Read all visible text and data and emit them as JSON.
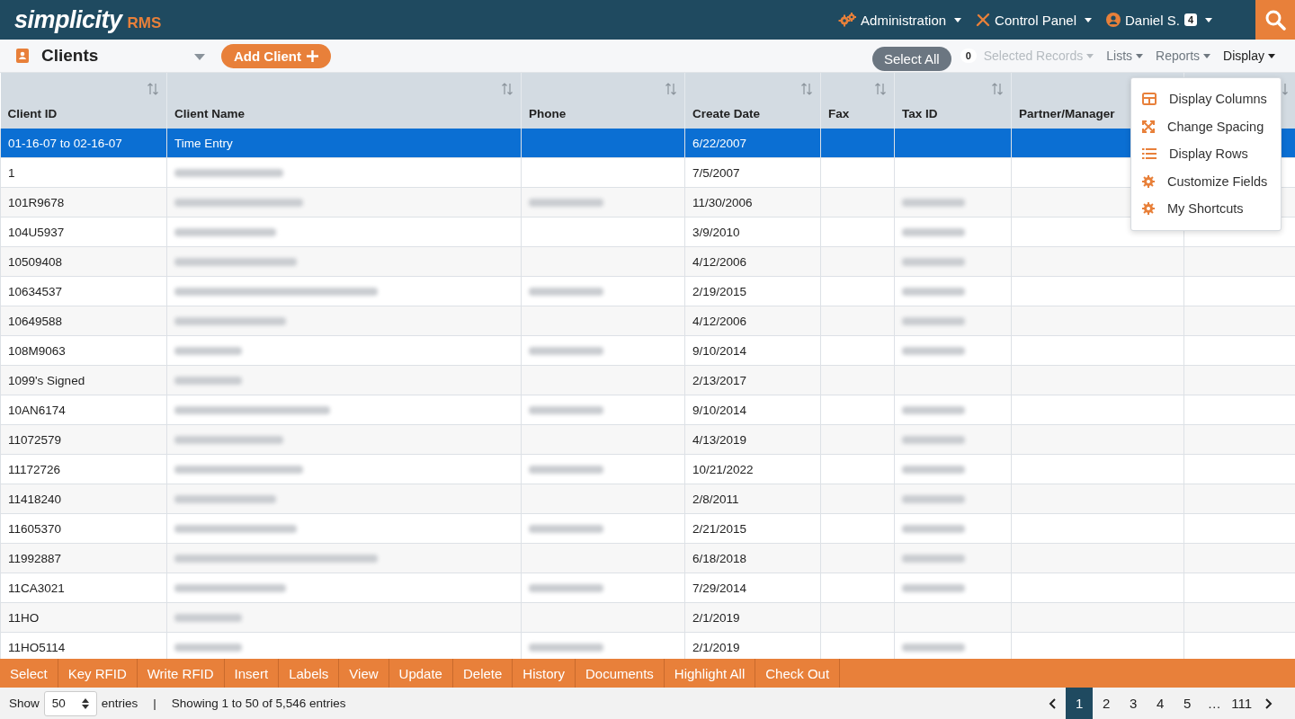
{
  "brand": {
    "name": "simplicity",
    "suffix": "RMS"
  },
  "nav": [
    {
      "kind": "gears",
      "label": "Administration"
    },
    {
      "kind": "tools",
      "label": "Control Panel"
    },
    {
      "kind": "user",
      "label": "Daniel S.",
      "badge": "4"
    }
  ],
  "page": {
    "title": "Clients",
    "add_button": "Add Client"
  },
  "actions": {
    "select_all": "Select All",
    "selected_count": "0",
    "menus": [
      {
        "label": "Selected Records",
        "disabled": true
      },
      {
        "label": "Lists",
        "disabled": false
      },
      {
        "label": "Reports",
        "disabled": false
      },
      {
        "label": "Display",
        "disabled": false,
        "expanded": true
      }
    ]
  },
  "display_menu": [
    {
      "kind": "table",
      "label": "Display Columns"
    },
    {
      "kind": "expand",
      "label": "Change Spacing"
    },
    {
      "kind": "list",
      "label": "Display Rows"
    },
    {
      "kind": "gear",
      "label": "Customize Fields"
    },
    {
      "kind": "gear",
      "label": "My Shortcuts"
    }
  ],
  "table": {
    "columns": [
      "Client ID",
      "Client Name",
      "Phone",
      "Create Date",
      "Fax",
      "Tax ID",
      "Partner/Manager"
    ],
    "rows": [
      {
        "client_id": "01-16-07 to 02-16-07",
        "client_name": "Time Entry",
        "name_blurred": false,
        "phone_blurred": false,
        "create_date": "6/22/2007",
        "tax_blurred": false,
        "selected": true
      },
      {
        "client_id": "1",
        "name_blurred": true,
        "phone_blurred": false,
        "create_date": "7/5/2007",
        "tax_blurred": false,
        "selected": false
      },
      {
        "client_id": "101R9678",
        "name_blurred": true,
        "phone_blurred": true,
        "create_date": "11/30/2006",
        "tax_blurred": true,
        "selected": false
      },
      {
        "client_id": "104U5937",
        "name_blurred": true,
        "phone_blurred": false,
        "create_date": "3/9/2010",
        "tax_blurred": true,
        "selected": false
      },
      {
        "client_id": "10509408",
        "name_blurred": true,
        "phone_blurred": false,
        "create_date": "4/12/2006",
        "tax_blurred": true,
        "selected": false
      },
      {
        "client_id": "10634537",
        "name_blurred": true,
        "phone_blurred": true,
        "create_date": "2/19/2015",
        "tax_blurred": true,
        "selected": false
      },
      {
        "client_id": "10649588",
        "name_blurred": true,
        "phone_blurred": false,
        "create_date": "4/12/2006",
        "tax_blurred": true,
        "selected": false
      },
      {
        "client_id": "108M9063",
        "name_blurred": true,
        "phone_blurred": true,
        "create_date": "9/10/2014",
        "tax_blurred": true,
        "selected": false
      },
      {
        "client_id": "1099's Signed",
        "name_blurred": true,
        "phone_blurred": false,
        "create_date": "2/13/2017",
        "tax_blurred": false,
        "selected": false
      },
      {
        "client_id": "10AN6174",
        "name_blurred": true,
        "phone_blurred": true,
        "create_date": "9/10/2014",
        "tax_blurred": true,
        "selected": false
      },
      {
        "client_id": "11072579",
        "name_blurred": true,
        "phone_blurred": false,
        "create_date": "4/13/2019",
        "tax_blurred": true,
        "selected": false
      },
      {
        "client_id": "11172726",
        "name_blurred": true,
        "phone_blurred": true,
        "create_date": "10/21/2022",
        "tax_blurred": true,
        "selected": false
      },
      {
        "client_id": "11418240",
        "name_blurred": true,
        "phone_blurred": false,
        "create_date": "2/8/2011",
        "tax_blurred": true,
        "selected": false
      },
      {
        "client_id": "11605370",
        "name_blurred": true,
        "phone_blurred": true,
        "create_date": "2/21/2015",
        "tax_blurred": true,
        "selected": false
      },
      {
        "client_id": "11992887",
        "name_blurred": true,
        "phone_blurred": false,
        "create_date": "6/18/2018",
        "tax_blurred": true,
        "selected": false
      },
      {
        "client_id": "11CA3021",
        "name_blurred": true,
        "phone_blurred": true,
        "create_date": "7/29/2014",
        "tax_blurred": true,
        "selected": false
      },
      {
        "client_id": "11HO",
        "name_blurred": true,
        "phone_blurred": false,
        "create_date": "2/1/2019",
        "tax_blurred": false,
        "selected": false
      },
      {
        "client_id": "11HO5114",
        "name_blurred": true,
        "phone_blurred": true,
        "create_date": "2/1/2019",
        "tax_blurred": true,
        "selected": false
      }
    ]
  },
  "bottom_actions": [
    "Select",
    "Key RFID",
    "Write RFID",
    "Insert",
    "Labels",
    "View",
    "Update",
    "Delete",
    "History",
    "Documents",
    "Highlight All",
    "Check Out"
  ],
  "footer": {
    "show_label": "Show",
    "page_size": "50",
    "entries_label": "entries",
    "separator": "|",
    "summary": "Showing 1 to 50 of 5,546 entries",
    "pages": [
      {
        "label": "1",
        "selected": true
      },
      {
        "label": "2",
        "selected": false
      },
      {
        "label": "3",
        "selected": false
      },
      {
        "label": "4",
        "selected": false
      },
      {
        "label": "5",
        "selected": false
      },
      {
        "label": "…",
        "selected": false
      },
      {
        "label": "111",
        "selected": false
      }
    ]
  }
}
